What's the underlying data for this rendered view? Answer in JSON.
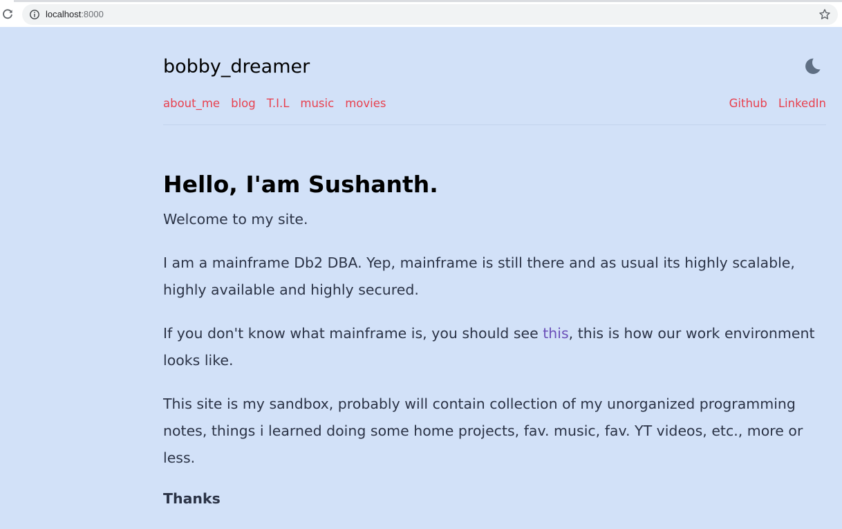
{
  "browser": {
    "url_host": "localhost",
    "url_port": ":8000"
  },
  "site": {
    "title": "bobby_dreamer"
  },
  "nav": {
    "links": [
      "about_me",
      "blog",
      "T.I.L",
      "music",
      "movies"
    ],
    "social": [
      "Github",
      "LinkedIn"
    ]
  },
  "content": {
    "heading": "Hello, I'am Sushanth.",
    "welcome": "Welcome to my site.",
    "p2": "I am a mainframe Db2 DBA. Yep, mainframe is still there and as usual its highly scalable, highly available and highly secured.",
    "p3_before": "If you don't know what mainframe is, you should see ",
    "p3_link": "this",
    "p3_after": ", this is how our work environment looks like.",
    "p4": "This site is my sandbox, probably will contain collection of my unorganized programming notes, things i learned doing some home projects, fav. music, fav. YT videos, etc., more or less.",
    "thanks": "Thanks"
  },
  "colors": {
    "page_background": "#d2e1f8",
    "nav_link": "#e8414f",
    "inline_link": "#6b4fb8",
    "moon_icon": "#5f6f84"
  },
  "icons": {
    "reload": "reload-icon",
    "site_info": "info-icon",
    "bookmark": "star-icon",
    "theme_toggle": "moon-icon"
  }
}
